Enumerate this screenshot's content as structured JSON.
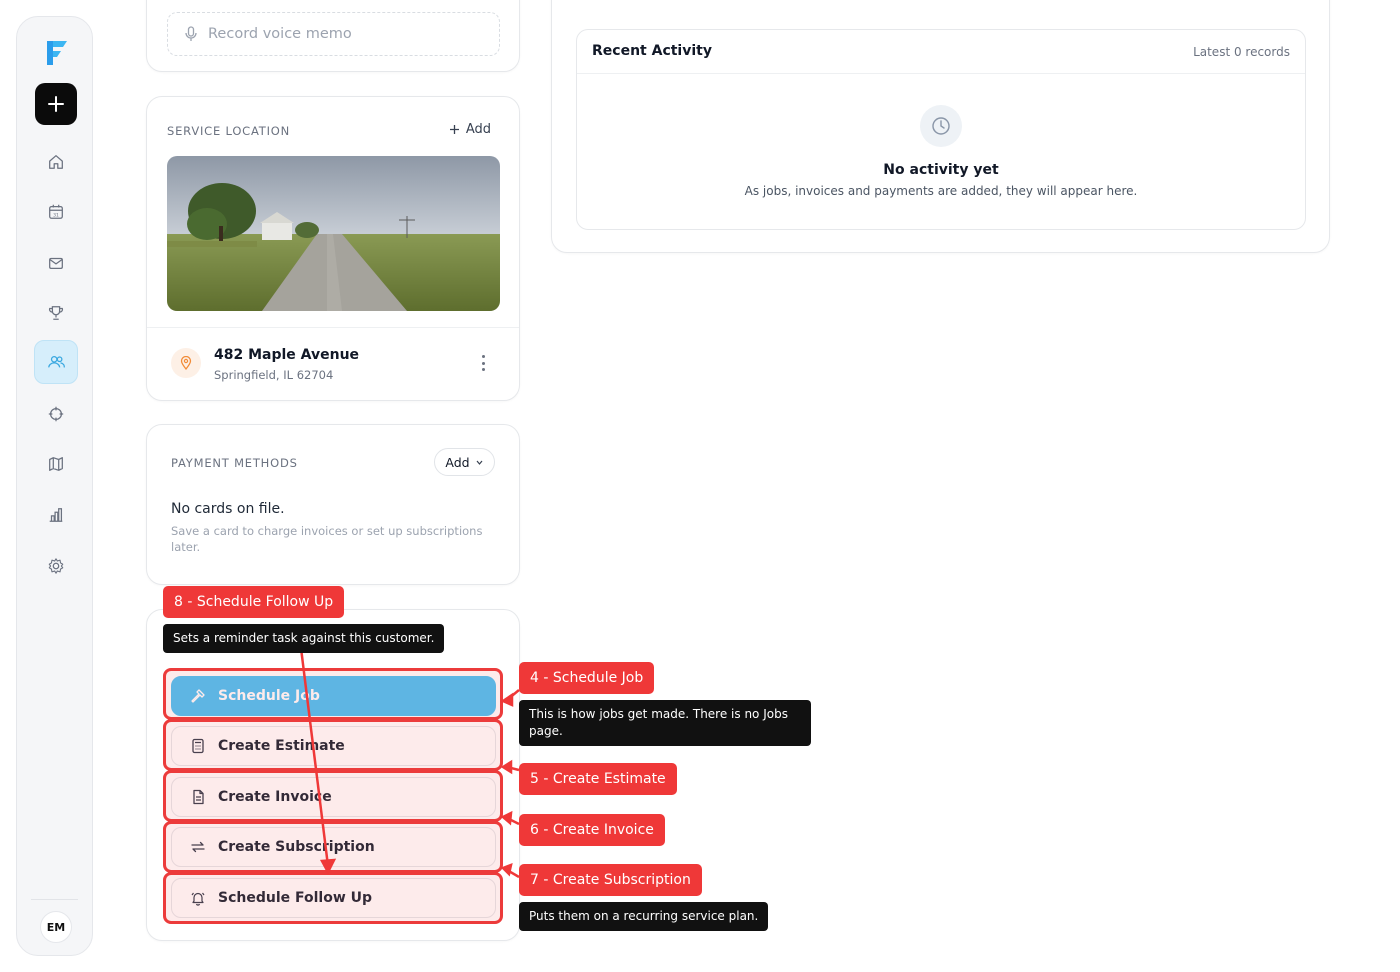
{
  "sidebar": {
    "nav_items": [
      "home",
      "calendar",
      "inbox",
      "trophy",
      "customers",
      "target",
      "map",
      "reports",
      "settings"
    ],
    "active_item": "customers",
    "avatar_initials": "EM",
    "accent_color": "#d6eefb"
  },
  "voice_memo": {
    "placeholder": "Record voice memo"
  },
  "service_location": {
    "title": "SERVICE LOCATION",
    "add_label": "Add",
    "address_line1": "482 Maple Avenue",
    "address_line2": "Springfield, IL 62704"
  },
  "payment_methods": {
    "title": "PAYMENT METHODS",
    "add_label": "Add",
    "empty_title": "No cards on file.",
    "empty_sub": "Save a card to charge invoices or set up subscriptions later."
  },
  "actions": [
    {
      "label": "Schedule Job",
      "icon": "hammer-icon",
      "primary": true
    },
    {
      "label": "Create Estimate",
      "icon": "calculator-icon",
      "primary": false
    },
    {
      "label": "Create Invoice",
      "icon": "document-icon",
      "primary": false
    },
    {
      "label": "Create Subscription",
      "icon": "repeat-icon",
      "primary": false
    },
    {
      "label": "Schedule Follow Up",
      "icon": "bell-icon",
      "primary": false
    }
  ],
  "recent_activity": {
    "title": "Recent Activity",
    "count_label": "Latest 0 records",
    "empty_title": "No activity yet",
    "empty_sub": "As jobs, invoices and payments are added, they will appear here."
  },
  "annotations": {
    "tag8": "8 - Schedule Follow Up",
    "tip8": "Sets a reminder task against this customer.",
    "tag4": "4 - Schedule Job",
    "tip4": "This is how jobs get made. There is no Jobs page.",
    "tag5": "5 - Create Estimate",
    "tag6": "6 - Create Invoice",
    "tag7": "7 - Create Subscription",
    "tip7": "Puts them on a recurring service plan.",
    "color": "#ef3838"
  }
}
